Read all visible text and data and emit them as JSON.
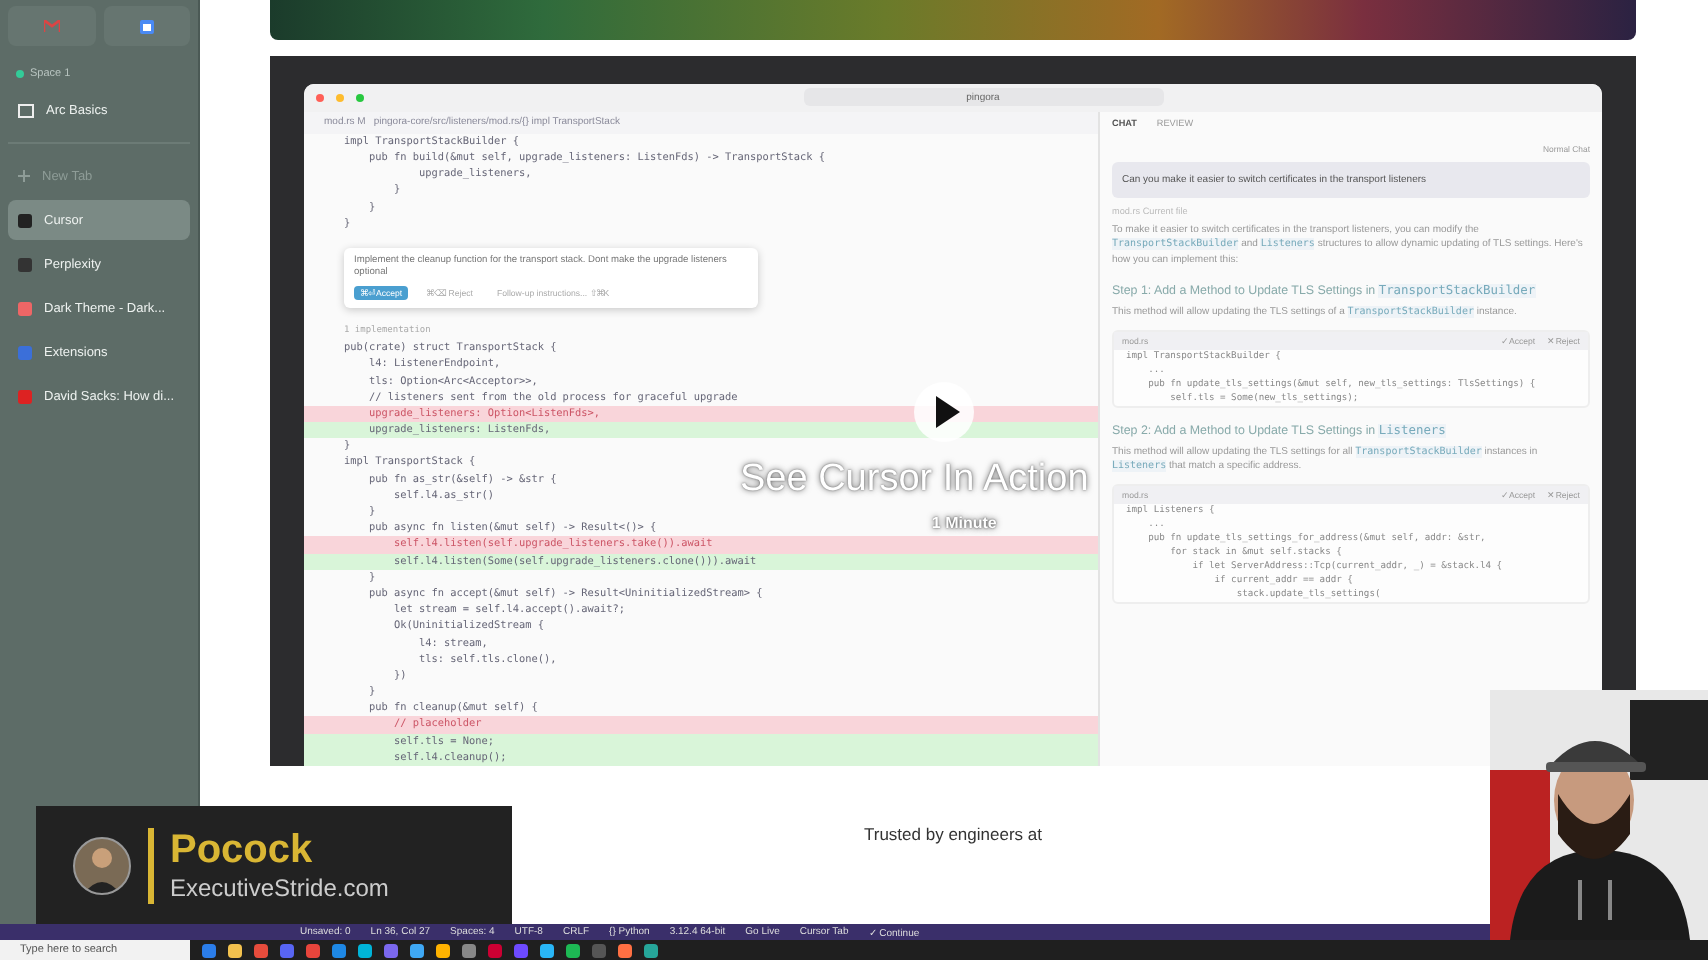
{
  "sidebar": {
    "space": "Space 1",
    "pinned": "Arc Basics",
    "new_tab": "New Tab",
    "tabs": [
      {
        "label": "Cursor",
        "selected": true
      },
      {
        "label": "Perplexity",
        "selected": false
      },
      {
        "label": "Dark Theme - Dark...",
        "selected": false
      },
      {
        "label": "Extensions",
        "selected": false
      },
      {
        "label": "David Sacks: How di...",
        "selected": false
      }
    ]
  },
  "video": {
    "title": "See Cursor In Action",
    "duration": "1 Minute",
    "editor": {
      "search": "pingora",
      "breadcrumb_file": "mod.rs M",
      "breadcrumb_path": "pingora-core/src/listeners/mod.rs/{} impl TransportStack",
      "lines_top": [
        {
          "text": "impl TransportStackBuilder {",
          "kind": "context"
        },
        {
          "text": "    pub fn build(&mut self, upgrade_listeners: ListenFds) -> TransportStack {",
          "kind": "context"
        },
        {
          "text": "            upgrade_listeners,",
          "kind": "context"
        },
        {
          "text": "        }",
          "kind": "context"
        },
        {
          "text": "    }",
          "kind": "context"
        },
        {
          "text": "}",
          "kind": "context"
        }
      ],
      "prompt": {
        "text": "Implement the cleanup function for the transport stack. Dont make the upgrade listeners optional",
        "accept": "⌘⏎ Accept",
        "reject": "⌘⌫ Reject",
        "followup": "Follow-up instructions... ⇧⌘K"
      },
      "lines_bottom": [
        {
          "text": "1 implementation",
          "kind": "lens"
        },
        {
          "text": "pub(crate) struct TransportStack {",
          "kind": "context"
        },
        {
          "text": "    l4: ListenerEndpoint,",
          "kind": "context"
        },
        {
          "text": "    tls: Option<Arc<Acceptor>>,",
          "kind": "context"
        },
        {
          "text": "    // listeners sent from the old process for graceful upgrade",
          "kind": "context"
        },
        {
          "text": "    upgrade_listeners: Option<ListenFds>,",
          "kind": "removed"
        },
        {
          "text": "    upgrade_listeners: ListenFds,",
          "kind": "added"
        },
        {
          "text": "}",
          "kind": "context"
        },
        {
          "text": "impl TransportStack {",
          "kind": "context"
        },
        {
          "text": "    pub fn as_str(&self) -> &str {",
          "kind": "context"
        },
        {
          "text": "        self.l4.as_str()",
          "kind": "context"
        },
        {
          "text": "    }",
          "kind": "context"
        },
        {
          "text": "    pub async fn listen(&mut self) -> Result<()> {",
          "kind": "context"
        },
        {
          "text": "        self.l4.listen(self.upgrade_listeners.take()).await",
          "kind": "removed"
        },
        {
          "text": "        self.l4.listen(Some(self.upgrade_listeners.clone())).await",
          "kind": "added"
        },
        {
          "text": "    }",
          "kind": "context"
        },
        {
          "text": "    pub async fn accept(&mut self) -> Result<UninitializedStream> {",
          "kind": "context"
        },
        {
          "text": "        let stream = self.l4.accept().await?;",
          "kind": "context"
        },
        {
          "text": "        Ok(UninitializedStream {",
          "kind": "context"
        },
        {
          "text": "            l4: stream,",
          "kind": "context"
        },
        {
          "text": "            tls: self.tls.clone(),",
          "kind": "context"
        },
        {
          "text": "        })",
          "kind": "context"
        },
        {
          "text": "    }",
          "kind": "context"
        },
        {
          "text": "    pub fn cleanup(&mut self) {",
          "kind": "context"
        },
        {
          "text": "        // placeholder",
          "kind": "removed"
        },
        {
          "text": "        self.tls = None;",
          "kind": "added"
        },
        {
          "text": "        self.l4.cleanup();",
          "kind": "added"
        }
      ]
    },
    "chat": {
      "tabs": [
        {
          "label": "CHAT",
          "selected": true
        },
        {
          "label": "REVIEW",
          "selected": false
        }
      ],
      "mode": "Normal Chat",
      "blocks": [
        {
          "kind": "user",
          "text": "Can you make it easier to switch certificates in the transport listeners"
        },
        {
          "kind": "context",
          "text": "mod.rs Current file"
        },
        {
          "kind": "paragraph",
          "segments": [
            {
              "text": "To make it easier to switch certificates in the transport listeners, you can modify the ",
              "kind": "text"
            },
            {
              "text": "TransportStackBuilder",
              "kind": "code"
            },
            {
              "text": " and ",
              "kind": "text"
            },
            {
              "text": "Listeners",
              "kind": "code"
            },
            {
              "text": " structures to allow dynamic updating of TLS settings. Here's how you can implement this:",
              "kind": "text"
            }
          ]
        },
        {
          "kind": "heading",
          "segments": [
            {
              "text": "Step 1: Add a Method to Update TLS Settings in ",
              "kind": "text"
            },
            {
              "text": "TransportStackBuilder",
              "kind": "code"
            }
          ]
        },
        {
          "kind": "paragraph",
          "segments": [
            {
              "text": "This method will allow updating the TLS settings of a ",
              "kind": "text"
            },
            {
              "text": "TransportStackBuilder",
              "kind": "code"
            },
            {
              "text": " instance.",
              "kind": "text"
            }
          ]
        },
        {
          "kind": "code",
          "file": "mod.rs",
          "accept": "✓ Accept",
          "reject": "✕ Reject",
          "lines": [
            "impl TransportStackBuilder {",
            "    ...",
            "    pub fn update_tls_settings(&mut self, new_tls_settings: TlsSettings) {",
            "        self.tls = Some(new_tls_settings);"
          ]
        },
        {
          "kind": "heading",
          "segments": [
            {
              "text": "Step 2: Add a Method to Update TLS Settings in ",
              "kind": "text"
            },
            {
              "text": "Listeners",
              "kind": "code"
            }
          ]
        },
        {
          "kind": "paragraph",
          "segments": [
            {
              "text": "This method will allow updating the TLS settings for all ",
              "kind": "text"
            },
            {
              "text": "TransportStackBuilder",
              "kind": "code"
            },
            {
              "text": " instances in ",
              "kind": "text"
            },
            {
              "text": "Listeners",
              "kind": "code"
            },
            {
              "text": " that match a specific address.",
              "kind": "text"
            }
          ]
        },
        {
          "kind": "code",
          "file": "mod.rs",
          "accept": "✓ Accept",
          "reject": "✕ Reject",
          "lines": [
            "impl Listeners {",
            "    ...",
            "    pub fn update_tls_settings_for_address(&mut self, addr: &str,",
            "        for stack in &mut self.stacks {",
            "            if let ServerAddress::Tcp(current_addr, _) = &stack.l4 {",
            "                if current_addr == addr {",
            "                    stack.update_tls_settings("
          ]
        }
      ]
    }
  },
  "trusted": "Trusted by engineers at",
  "lower_third": {
    "name": "Pocock",
    "site": "ExecutiveStride.com"
  },
  "status_bar": [
    "Unsaved: 0",
    "Ln 36, Col 27",
    "Spaces: 4",
    "UTF-8",
    "CRLF",
    "{} Python",
    "3.12.4 64-bit",
    "Go Live",
    "Cursor Tab",
    "✓ Continue"
  ],
  "taskbar": {
    "search_placeholder": "Type here to search"
  }
}
